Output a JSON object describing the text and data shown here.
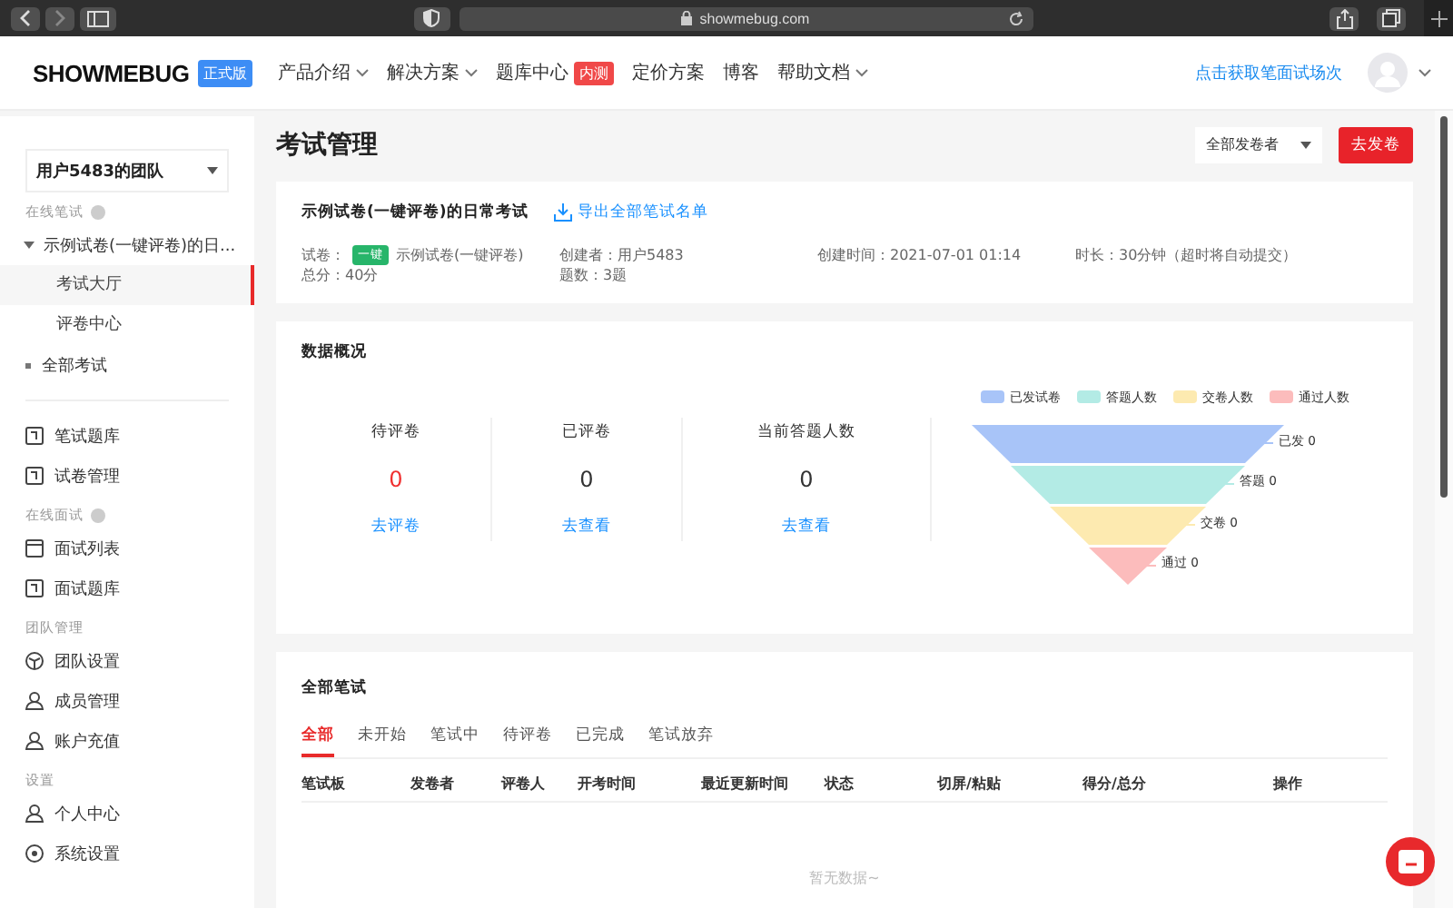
{
  "browser": {
    "url": "showmebug.com"
  },
  "nav": {
    "logo": "SHOWMEBUG",
    "edition": "正式版",
    "items": [
      {
        "label": "产品介绍",
        "dropdown": true
      },
      {
        "label": "解决方案",
        "dropdown": true
      },
      {
        "label": "题库中心",
        "dropdown": false,
        "badge": "内测"
      },
      {
        "label": "定价方案",
        "dropdown": false
      },
      {
        "label": "博客",
        "dropdown": false
      },
      {
        "label": "帮助文档",
        "dropdown": true
      }
    ],
    "cta": "点击获取笔面试场次"
  },
  "sidebar": {
    "team": "用户5483的团队",
    "items": [
      {
        "kind": "section",
        "label": "在线笔试",
        "help": true
      },
      {
        "kind": "tree",
        "label": "示例试卷(一键评卷)的日...",
        "expanded": true,
        "children": [
          {
            "label": "考试大厅",
            "selected": true
          },
          {
            "label": "评卷中心",
            "selected": false
          }
        ]
      },
      {
        "kind": "bullet",
        "label": "全部考试"
      },
      {
        "kind": "divider"
      },
      {
        "kind": "link",
        "label": "笔试题库"
      },
      {
        "kind": "link",
        "label": "试卷管理"
      },
      {
        "kind": "section",
        "label": "在线面试",
        "help": true
      },
      {
        "kind": "link",
        "label": "面试列表"
      },
      {
        "kind": "link",
        "label": "面试题库"
      },
      {
        "kind": "section",
        "label": "团队管理",
        "help": false
      },
      {
        "kind": "link",
        "label": "团队设置"
      },
      {
        "kind": "link",
        "label": "成员管理"
      },
      {
        "kind": "link",
        "label": "账户充值"
      },
      {
        "kind": "section",
        "label": "设置",
        "help": false
      },
      {
        "kind": "link",
        "label": "个人中心"
      },
      {
        "kind": "link",
        "label": "系统设置"
      }
    ]
  },
  "page": {
    "title": "考试管理",
    "filter": "全部发卷者",
    "action": "去发卷"
  },
  "exam": {
    "title": "示例试卷(一键评卷)的日常考试",
    "export": "导出全部笔试名单",
    "paper_label": "试卷：",
    "paper_tag": "一键",
    "paper": "示例试卷(一键评卷)",
    "score": "总分：40分",
    "fields": [
      {
        "lines": [
          "创建者：用户5483",
          "题数：3题"
        ]
      },
      {
        "lines": [
          "创建时间：2021-07-01 01:14"
        ]
      },
      {
        "lines": [
          "时长：30分钟（超时将自动提交）"
        ]
      }
    ]
  },
  "overview": {
    "title": "数据概况",
    "stats": [
      {
        "label": "待评卷",
        "value": "0",
        "link": "去评卷",
        "highlight": true
      },
      {
        "label": "已评卷",
        "value": "0",
        "link": "去查看",
        "highlight": false
      },
      {
        "label": "当前答题人数",
        "value": "0",
        "link": "去查看",
        "highlight": false
      }
    ],
    "funnel": {
      "legend": [
        {
          "label": "已发试卷",
          "color": "#a8c4f8"
        },
        {
          "label": "答题人数",
          "color": "#b3ebe5"
        },
        {
          "label": "交卷人数",
          "color": "#fdeab0"
        },
        {
          "label": "通过人数",
          "color": "#fcbcbc"
        }
      ],
      "stages": [
        {
          "label": "已发 0",
          "color": "#a8c4f8"
        },
        {
          "label": "答题 0",
          "color": "#b3ebe5"
        },
        {
          "label": "交卷 0",
          "color": "#fdeab0"
        },
        {
          "label": "通过 0",
          "color": "#fcbcbc"
        }
      ]
    }
  },
  "tests": {
    "title": "全部笔试",
    "tabs": [
      {
        "label": "全部",
        "selected": true
      },
      {
        "label": "未开始",
        "selected": false
      },
      {
        "label": "笔试中",
        "selected": false
      },
      {
        "label": "待评卷",
        "selected": false
      },
      {
        "label": "已完成",
        "selected": false
      },
      {
        "label": "笔试放弃",
        "selected": false
      }
    ],
    "columns": [
      "笔试板",
      "发卷者",
      "评卷人",
      "开考时间",
      "最近更新时间",
      "状态",
      "切屏/粘贴",
      "得分/总分",
      "操作"
    ],
    "empty": "暂无数据~"
  }
}
